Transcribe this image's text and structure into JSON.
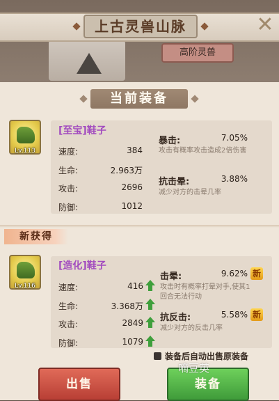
{
  "header": {
    "title": "上古灵兽山脉",
    "tier_badge": "高阶灵兽"
  },
  "current_section": {
    "title": "当前装备",
    "item": {
      "name": "[至宝]鞋子",
      "level": "Lv.113",
      "stats": [
        {
          "label": "速度:",
          "value": "384"
        },
        {
          "label": "生命:",
          "value": "2.963万"
        },
        {
          "label": "攻击:",
          "value": "2696"
        },
        {
          "label": "防御:",
          "value": "1012"
        }
      ],
      "effects": [
        {
          "name": "暴击:",
          "value": "7.05%",
          "desc": "攻击有概率攻击造成2倍伤害"
        },
        {
          "name": "抗击晕:",
          "value": "3.88%",
          "desc": "减少对方的击晕几率"
        }
      ]
    }
  },
  "new_section": {
    "tag": "新获得",
    "item": {
      "name": "[造化]鞋子",
      "level": "Lv.116",
      "stats": [
        {
          "label": "速度:",
          "value": "416"
        },
        {
          "label": "生命:",
          "value": "3.368万"
        },
        {
          "label": "攻击:",
          "value": "2849"
        },
        {
          "label": "防御:",
          "value": "1079"
        }
      ],
      "effects": [
        {
          "name": "击晕:",
          "value": "9.62%",
          "desc1": "攻击时有概率打晕对手,使其1",
          "desc2": "回合无法行动"
        },
        {
          "name": "抗反击:",
          "value": "5.58%",
          "desc1": "减少对方的反击几率"
        }
      ],
      "new_badge": "新"
    }
  },
  "footer": {
    "auto_sell_label": "装备后自动出售原装备",
    "watermark": "嘀豆英",
    "sell_label": "出售",
    "equip_label": "装备"
  },
  "colors": {
    "item_name": "#a24bbf",
    "increase_arrow": "#3f9f3c",
    "sell_button": "#c9493d",
    "equip_button": "#53b548"
  }
}
